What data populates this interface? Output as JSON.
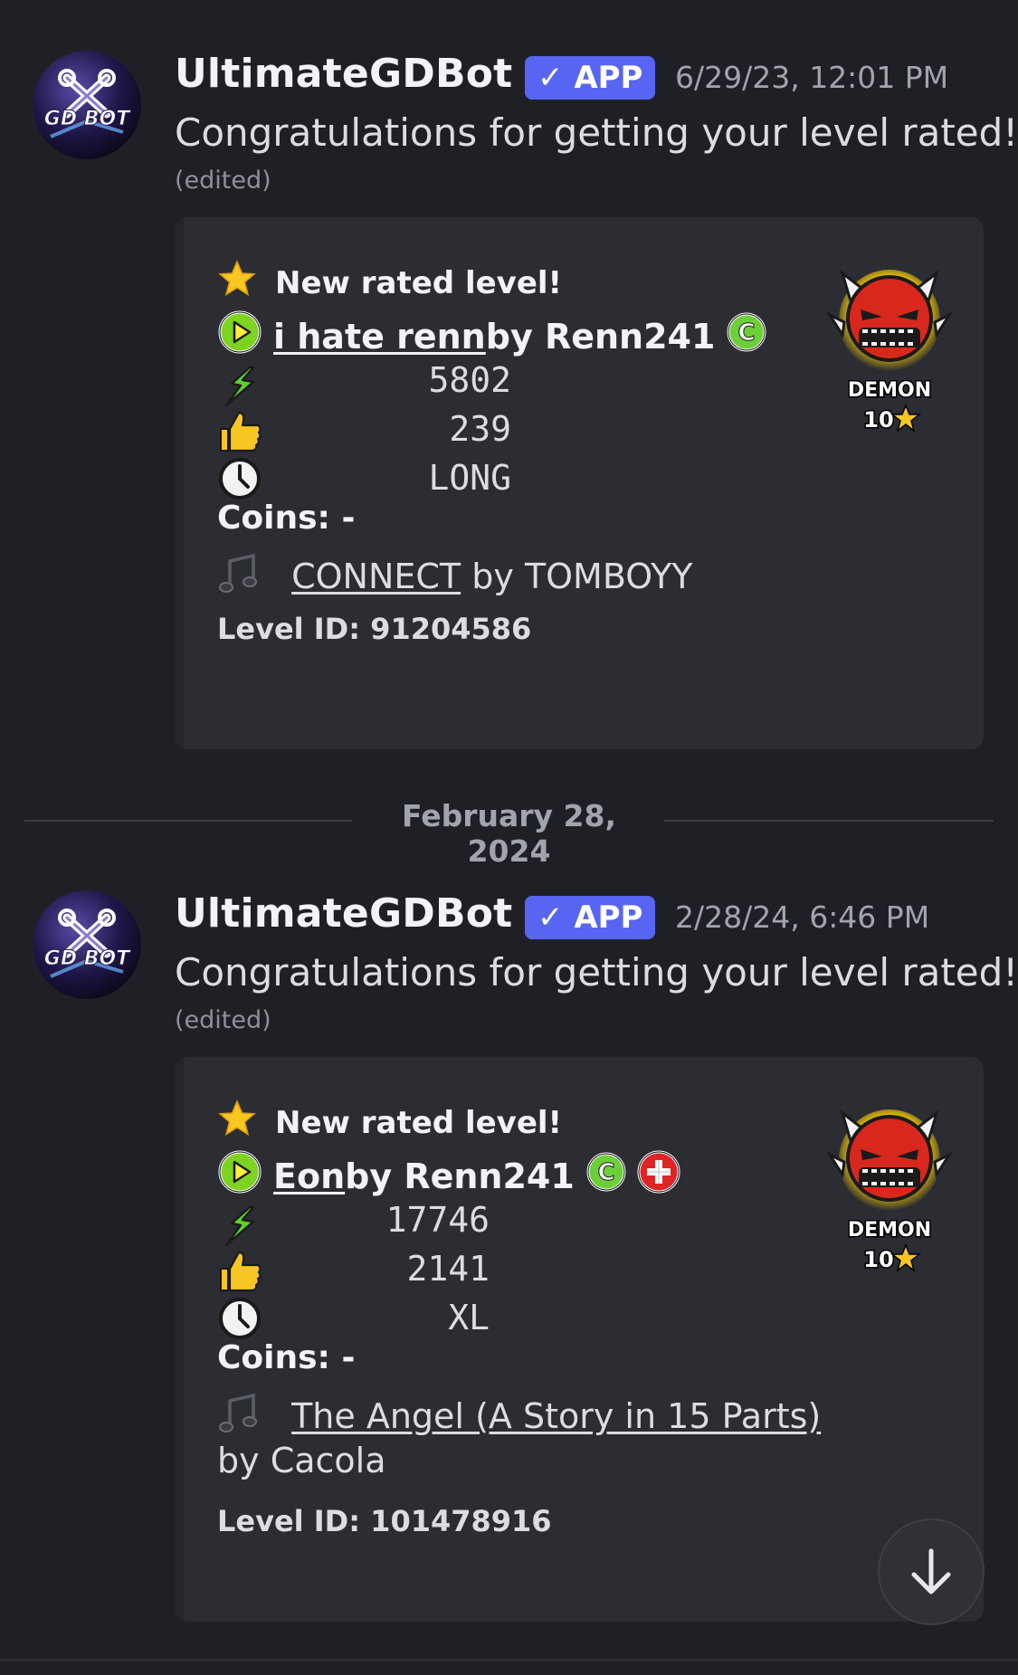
{
  "messages": [
    {
      "username": "UltimateGDBot",
      "app_badge": "✓ APP",
      "timestamp": "6/29/23, 12:01 PM",
      "text": "Congratulations for getting your level rated!",
      "edited": "(edited)",
      "embed": {
        "author": "New rated level!",
        "level_name": "i hate renn",
        "level_by": " by Renn241",
        "downloads": "5802",
        "likes": "239",
        "length": "LONG",
        "coins": "Coins: -",
        "song_name": "CONNECT",
        "song_by": " by TOMBOYY",
        "song_by_wrapped": "",
        "level_id": "Level ID: 91204586",
        "difficulty_label": "DEMON",
        "stars": "10",
        "has_featured_badge": false
      }
    },
    {
      "username": "UltimateGDBot",
      "app_badge": "✓ APP",
      "timestamp": "2/28/24, 6:46 PM",
      "text": "Congratulations for getting your level rated!",
      "edited": "(edited)",
      "embed": {
        "author": "New rated level!",
        "level_name": "Eon",
        "level_by": " by Renn241",
        "downloads": "17746",
        "likes": "2141",
        "length": "XL",
        "coins": "Coins: -",
        "song_name": "The Angel (A Story in 15 Parts)",
        "song_by": "",
        "song_by_wrapped": "by Cacola",
        "level_id": "Level ID: 101478916",
        "difficulty_label": "DEMON",
        "stars": "10",
        "has_featured_badge": true
      }
    }
  ],
  "date_separator": "February 28, 2024",
  "icons": {
    "avatar": "gd-bot-logo",
    "star": "star-icon",
    "play": "play-icon",
    "copy": "copy-c-icon",
    "downloads": "download-arrow-icon",
    "likes": "thumbs-up-icon",
    "length": "clock-icon",
    "song": "music-note-icon",
    "difficulty": "demon-face-icon",
    "scroll": "arrow-down-icon"
  },
  "colors": {
    "background": "#1f2026",
    "embed": "#2b2d33",
    "app_badge": "#5865f2",
    "star": "#f7c623",
    "play": "#7ed321",
    "demon": "#d8281e"
  },
  "avatar_text": "GD BOT"
}
